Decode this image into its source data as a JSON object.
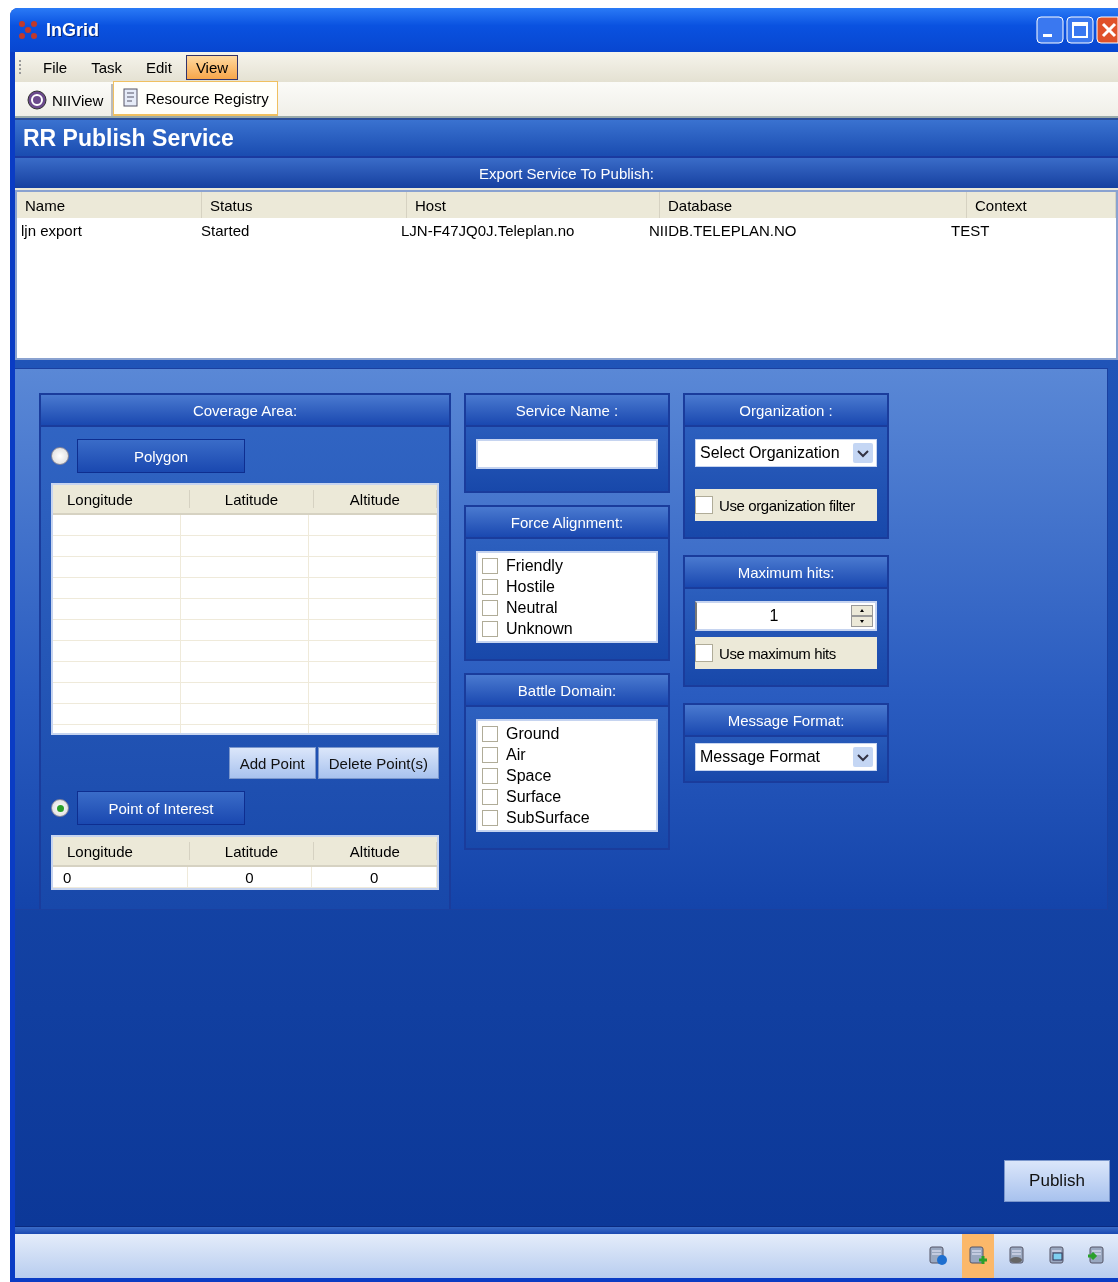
{
  "window": {
    "title": "InGrid"
  },
  "menu": [
    {
      "label": "File",
      "selected": false
    },
    {
      "label": "Task",
      "selected": false
    },
    {
      "label": "Edit",
      "selected": false
    },
    {
      "label": "View",
      "selected": true
    }
  ],
  "tabs": [
    {
      "label": "NIIView",
      "selected": false,
      "kind": "nii"
    },
    {
      "label": "Resource Registry",
      "selected": true,
      "kind": "registry"
    }
  ],
  "page_title": "RR Publish Service",
  "export": {
    "title": "Export Service To Publish:",
    "columns": [
      "Name",
      "Status",
      "Host",
      "Database",
      "Context"
    ],
    "rows": [
      [
        "ljn export",
        "Started",
        "LJN-F47JQ0J.Teleplan.no",
        "NIIDB.TELEPLAN.NO",
        "TEST"
      ]
    ]
  },
  "coverage": {
    "title": "Coverage Area:",
    "polygon": {
      "label": "Polygon",
      "selected": false
    },
    "polygon_table": {
      "columns": [
        "Longitude",
        "Latitude",
        "Altitude"
      ]
    },
    "buttons": [
      "Add Point",
      "Delete Point(s)"
    ],
    "point": {
      "label": "Point of Interest",
      "selected": true
    },
    "point_table": {
      "columns": [
        "Longitude",
        "Latitude",
        "Altitude"
      ],
      "rows": [
        [
          "0",
          "0",
          "0"
        ]
      ]
    }
  },
  "service_name": {
    "title": "Service Name :"
  },
  "force_alignment": {
    "title": "Force Alignment:",
    "options": [
      {
        "label": "Friendly",
        "checked": false
      },
      {
        "label": "Hostile",
        "checked": false
      },
      {
        "label": "Neutral",
        "checked": false
      },
      {
        "label": "Unknown",
        "checked": false
      }
    ]
  },
  "battle_domain": {
    "title": "Battle Domain:",
    "options": [
      {
        "label": "Ground",
        "checked": false
      },
      {
        "label": "Air",
        "checked": false
      },
      {
        "label": "Space",
        "checked": false
      },
      {
        "label": "Surface",
        "checked": false
      },
      {
        "label": "SubSurface",
        "checked": false
      }
    ]
  },
  "organization": {
    "title": "Organization :",
    "value": "Select Organization",
    "filter": {
      "label": "Use organization filter",
      "checked": false
    }
  },
  "maximum_hits": {
    "title": "Maximum hits:",
    "value": "1",
    "use": {
      "label": "Use maximum hits",
      "checked": false
    }
  },
  "message_format": {
    "title": "Message Format:",
    "value": "Message Format"
  },
  "publish_button": "Publish",
  "status_icons": [
    {
      "kind": "info",
      "selected": false
    },
    {
      "kind": "add",
      "selected": true
    },
    {
      "kind": "network",
      "selected": false
    },
    {
      "kind": "search",
      "selected": false
    },
    {
      "kind": "import",
      "selected": false
    }
  ]
}
